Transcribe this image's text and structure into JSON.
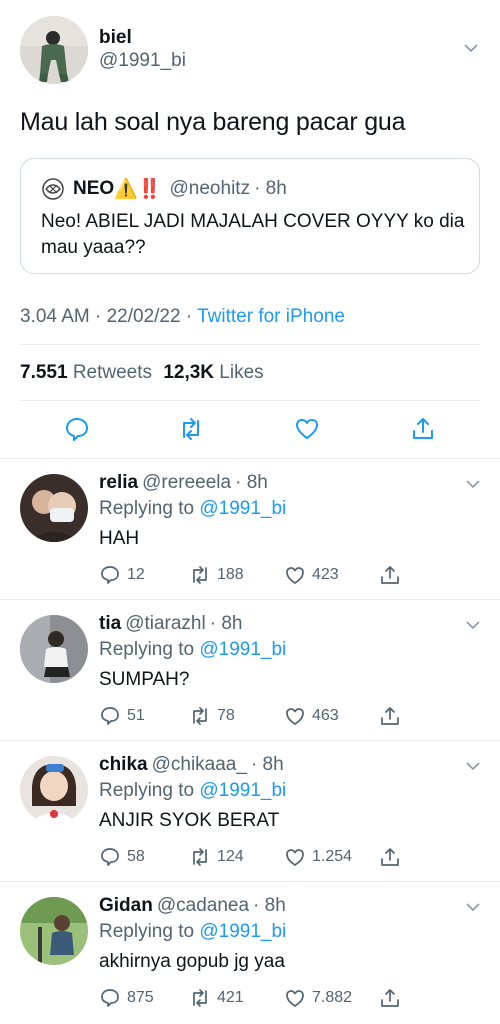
{
  "main": {
    "name": "biel",
    "handle": "@1991_bi",
    "text": "Mau lah soal nya bareng pacar gua",
    "quote": {
      "name": "NEO",
      "emoji": "⚠️‼️",
      "handle": "@neohitz",
      "time": "· 8h",
      "text": "Neo! ABIEL JADI MAJALAH COVER OYYY ko dia mau yaaa??"
    },
    "timestamp": "3.04 AM · 22/02/22 · ",
    "source": "Twitter for iPhone",
    "retweets_count": "7.551",
    "retweets_label": "Retweets",
    "likes_count": "12,3K",
    "likes_label": "Likes"
  },
  "replies": [
    {
      "name": "relia",
      "handle": "@rereeela",
      "time": "· 8h",
      "replying_label": "Replying to ",
      "replying_to": "@1991_bi",
      "text": "HAH",
      "replies": "12",
      "retweets": "188",
      "likes": "423"
    },
    {
      "name": "tia",
      "handle": "@tiarazhl",
      "time": "· 8h",
      "replying_label": "Replying to ",
      "replying_to": "@1991_bi",
      "text": "SUMPAH?",
      "replies": "51",
      "retweets": "78",
      "likes": "463"
    },
    {
      "name": "chika",
      "handle": "@chikaaa_",
      "time": "· 8h",
      "replying_label": "Replying to ",
      "replying_to": "@1991_bi",
      "text": "ANJIR SYOK BERAT",
      "replies": "58",
      "retweets": "124",
      "likes": "1.254"
    },
    {
      "name": "Gidan",
      "handle": "@cadanea",
      "time": "· 8h",
      "replying_label": "Replying to ",
      "replying_to": "@1991_bi",
      "text": "akhirnya gopub jg yaa",
      "replies": "875",
      "retweets": "421",
      "likes": "7.882"
    }
  ],
  "colors": {
    "link": "#1d9bf0",
    "muted": "#536471",
    "text": "#0f1419",
    "divider": "#e7ebee"
  },
  "icons": [
    "chevron-down-icon",
    "reply-icon",
    "retweet-icon",
    "like-icon",
    "share-icon",
    "avatar-photo"
  ]
}
